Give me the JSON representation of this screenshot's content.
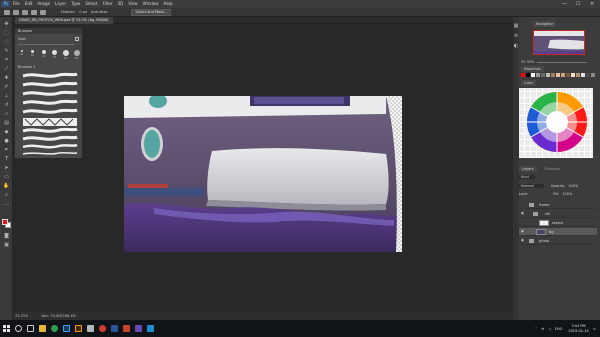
{
  "app": {
    "logo": "Ps",
    "menu": [
      "File",
      "Edit",
      "Image",
      "Layer",
      "Type",
      "Select",
      "Filter",
      "3D",
      "View",
      "Window",
      "Help"
    ],
    "window_controls": [
      "—",
      "☐",
      "✕"
    ]
  },
  "options_bar": {
    "feather_label": "Feather:",
    "feather_value": "0 px",
    "antialias_label": "Anti-alias",
    "select_mask_label": "Select and Mask..."
  },
  "document": {
    "tab_title": "DSARI_DB_PHOTOS_WEB.psd @ 33.3% (bg, RGB/8)"
  },
  "brushes_panel": {
    "title": "Brushes",
    "size_label": "Size:",
    "folder_label": "Brushes 1",
    "presets": [
      "10",
      "10",
      "10",
      "10",
      "10",
      "10"
    ]
  },
  "status_bar": {
    "zoom": "33.33%",
    "doc_info": "Doc: 35.6M/286.4M"
  },
  "right_panels": {
    "navigator_tab": "Navigator",
    "navigator_zoom": "33.33%",
    "swatches_tab": "Swatches",
    "color_wheel_tab": "Color",
    "layers_tab": "Layers",
    "channels_tab": "Channels",
    "kind_label": "Kind",
    "blend_mode": "Normal",
    "opacity_label": "Opacity:",
    "opacity_value": "100%",
    "lock_label": "Lock:",
    "fill_label": "Fill:",
    "fill_value": "100%",
    "layers": [
      {
        "name": "frame",
        "visible": false,
        "selected": false
      },
      {
        "name": "ref",
        "visible": true,
        "selected": false
      },
      {
        "name": "sketch",
        "visible": false,
        "selected": false
      },
      {
        "name": "bg",
        "visible": true,
        "selected": true
      },
      {
        "name": "photo",
        "visible": true,
        "selected": false
      }
    ]
  },
  "taskbar": {
    "apps": [
      "explorer",
      "chrome",
      "photoshop",
      "illustrator",
      "files",
      "media",
      "word",
      "settings",
      "app",
      "app",
      "app"
    ],
    "tray_lang": "ENG",
    "time": "3:04 PM",
    "date": "2019-01-14"
  },
  "colors": {
    "foreground": "#e31b1b",
    "background": "#ffffff",
    "canvas_bg": "#282828",
    "panel_bg": "#3c3c3c"
  }
}
